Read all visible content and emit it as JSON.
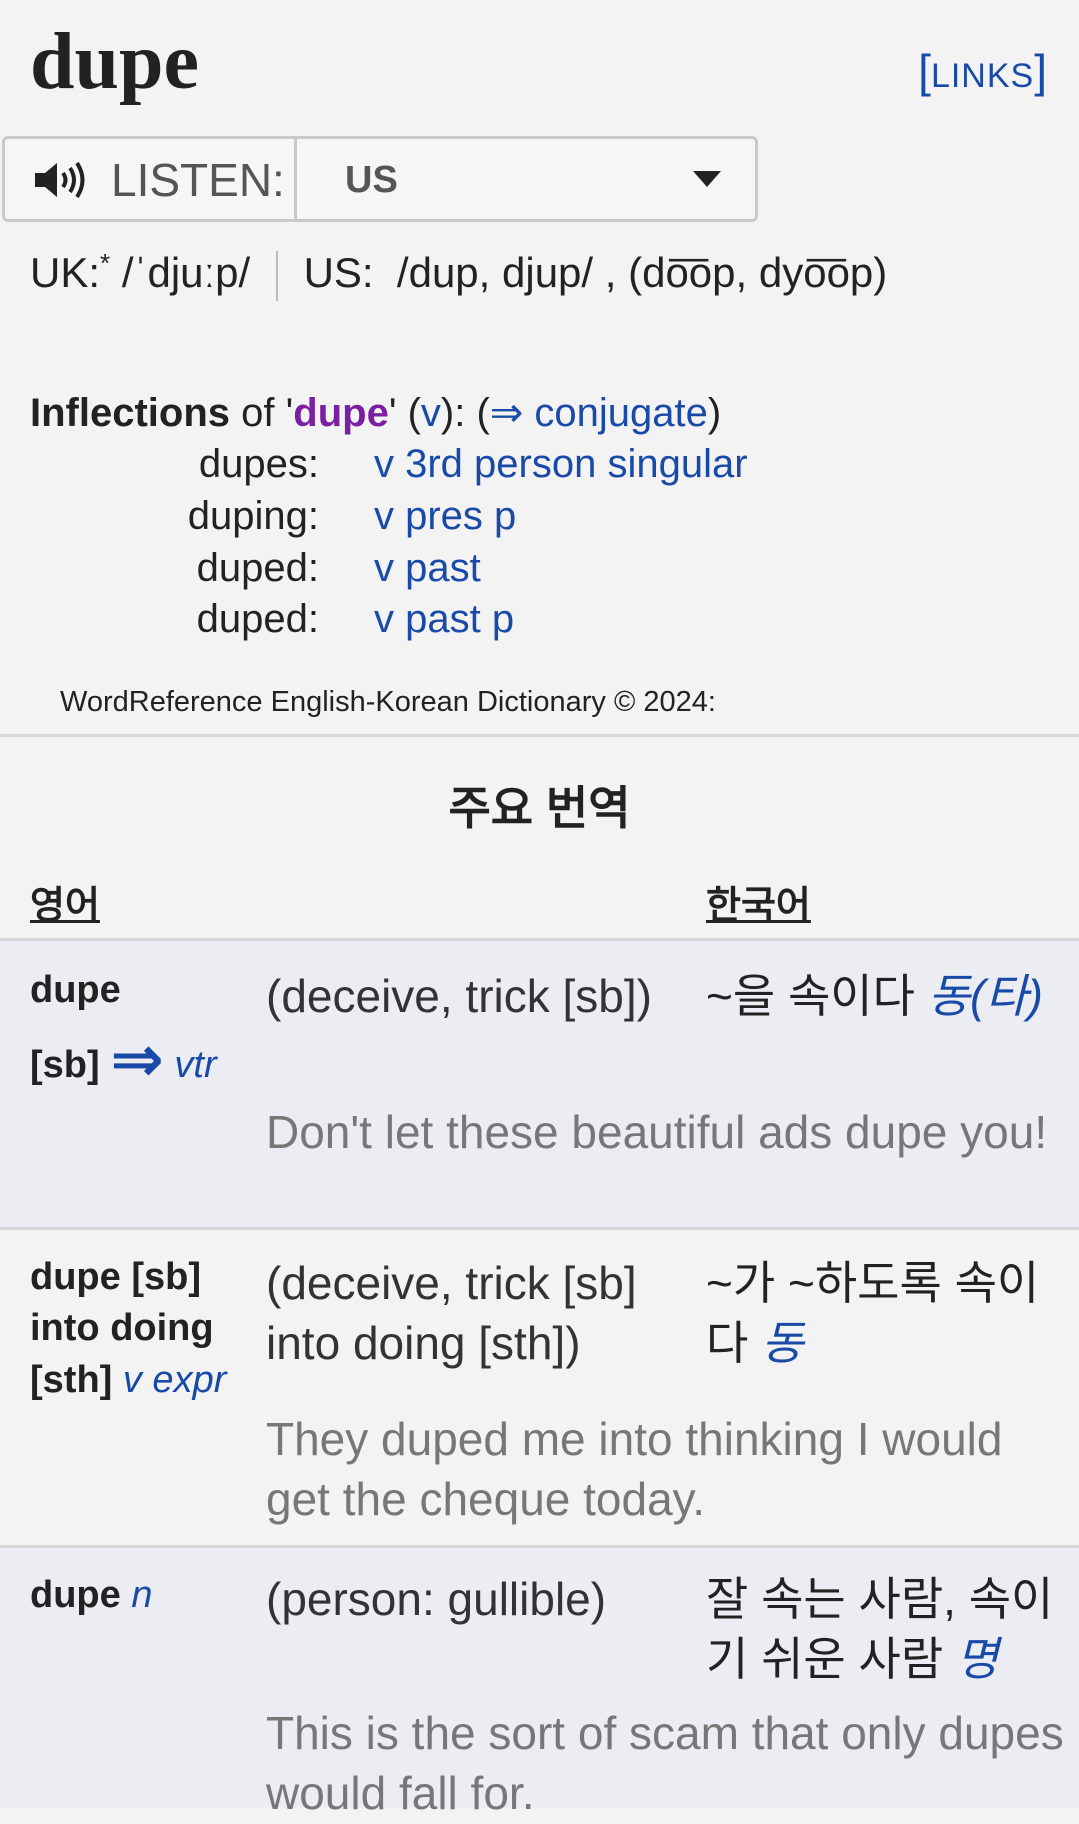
{
  "headword": "dupe",
  "links_label": "LINKS",
  "listen": {
    "label": "LISTEN:",
    "selected_accent": "US"
  },
  "pronunciation": {
    "uk_label": "UK:",
    "uk_marker": "*",
    "uk_ipa": "/ˈdjuːp/",
    "us_label": "US:",
    "us_ipa": "/dup, djup/ ,",
    "us_respell": "(do͞op, dyo͞op)"
  },
  "inflections": {
    "title_bold": "Inflections",
    "title_of": "of '",
    "word": "dupe",
    "pos": "v",
    "conjugate_label": "⇒ conjugate",
    "rows": [
      {
        "form": "dupes:",
        "desc": "v 3rd person singular"
      },
      {
        "form": "duping:",
        "desc": "v pres p"
      },
      {
        "form": "duped:",
        "desc": "v past"
      },
      {
        "form": "duped:",
        "desc": "v past p"
      }
    ]
  },
  "copyright": "WordReference English-Korean Dictionary © 2024:",
  "section_title": "주요 번역",
  "col_en": "영어",
  "col_ko": "한국어",
  "entries": [
    {
      "term_line1": "dupe",
      "term_line2": "[sb]",
      "arrow": "⇒",
      "pos": "vtr",
      "sense": "(deceive, trick [sb])",
      "ko": "~을 속이다",
      "ko_pos": "동(타)",
      "example": "Don't let these beautiful ads dupe you!"
    },
    {
      "term_line1": "dupe [sb]",
      "term_line2": "into doing",
      "term_line3": "[sth]",
      "pos": "v expr",
      "sense_line1": "(deceive, trick [sb]",
      "sense_line2": "into doing [sth])",
      "ko_line1": "~가 ~하도록 속이",
      "ko_line2": "다",
      "ko_pos": "동",
      "example": "They duped me into thinking I would get the cheque today."
    },
    {
      "term_line1": "dupe",
      "pos": "n",
      "sense": "(person: gullible)",
      "ko_line1": "잘 속는 사람, 속이",
      "ko_line2": "기 쉬운 사람",
      "ko_pos": "명",
      "example": "This is the sort of scam that only dupes would fall for."
    }
  ]
}
